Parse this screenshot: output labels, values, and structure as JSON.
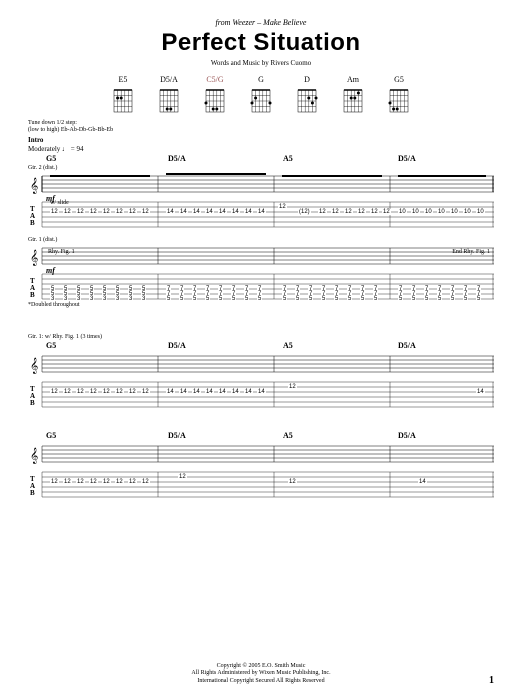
{
  "header": {
    "from_line": "from Weezer – Make Believe",
    "title": "Perfect Situation",
    "credits": "Words and Music by Rivers Cuomo"
  },
  "chords": [
    {
      "name": "E5",
      "highlight": false
    },
    {
      "name": "D5/A",
      "highlight": false
    },
    {
      "name": "C5/G",
      "highlight": true
    },
    {
      "name": "G",
      "highlight": false
    },
    {
      "name": "D",
      "highlight": false
    },
    {
      "name": "Am",
      "highlight": false
    },
    {
      "name": "G5",
      "highlight": false
    }
  ],
  "tuning": {
    "line1": "Tune down 1/2 step:",
    "line2": "(low to high) Eb-Ab-Db-Gb-Bb-Eb"
  },
  "intro": {
    "section": "Intro",
    "tempo": "Moderately ♩ = 94",
    "gtr1": "Gtr. 2 (dist.)",
    "gtr2": "Gtr. 1 (dist.)",
    "dynamic": "mf",
    "tech": "w/ slide",
    "rhy_fig": "Rhy. Fig. 1",
    "end_rhy": "End Rhy. Fig. 1",
    "doubled": "*Doubled throughout"
  },
  "chord_progression": {
    "c1": "G5",
    "c2": "D5/A",
    "c3": "A5",
    "c4": "D5/A"
  },
  "system2_label": "Gtr. 1: w/ Rhy. Fig. 1 (3 times)",
  "tab_data": {
    "sys1_gtr2": {
      "bar1": [
        "12",
        "12",
        "12",
        "12",
        "12",
        "12",
        "12",
        "12"
      ],
      "bar2": [
        "14",
        "14",
        "14",
        "14",
        "14",
        "14",
        "14",
        "14"
      ],
      "bar3_slide": "12",
      "bar3": [
        "(12)",
        "12",
        "12",
        "12",
        "12",
        "12",
        "12"
      ],
      "bar4": [
        "10",
        "10",
        "10",
        "10",
        "10",
        "10",
        "10",
        "10"
      ]
    },
    "sys1_gtr1": {
      "strings_35": [
        "5",
        "5",
        "5",
        "5",
        "5",
        "5",
        "5",
        "5"
      ],
      "strings_35b": [
        "3",
        "3",
        "3",
        "3",
        "3",
        "3",
        "3",
        "3"
      ],
      "bar2_top": [
        "7",
        "7",
        "7",
        "7",
        "7",
        "7",
        "7",
        "7"
      ],
      "bar2_bot": [
        "5",
        "5",
        "5",
        "5",
        "5",
        "5",
        "5",
        "5"
      ],
      "bar3_top": [
        "7",
        "7",
        "7",
        "7",
        "7",
        "7",
        "7",
        "7"
      ],
      "bar3_bot": [
        "5",
        "5",
        "5",
        "5",
        "5",
        "5",
        "5",
        "5"
      ],
      "bar4_top": [
        "7",
        "7",
        "7",
        "7",
        "7",
        "7",
        "7",
        "7"
      ],
      "bar4_bot": [
        "5",
        "5",
        "5",
        "5",
        "5",
        "5",
        "5",
        "5"
      ]
    },
    "sys2": {
      "bar1": [
        "12",
        "12",
        "12",
        "12",
        "12",
        "12",
        "12",
        "12"
      ],
      "bar2": [
        "14",
        "14",
        "14",
        "14",
        "14",
        "14",
        "14",
        "14"
      ],
      "bar3_hold": "12",
      "bar4_end": "14"
    },
    "sys3": {
      "bar1": [
        "12",
        "12",
        "12",
        "12",
        "12",
        "12",
        "12",
        "12"
      ],
      "bar2_slide": "12",
      "bar3": "12",
      "bar4": "14"
    }
  },
  "footer": {
    "copyright": "Copyright © 2005 E.O. Smith Music",
    "rights1": "All Rights Administered by Wixen Music Publishing, Inc.",
    "rights2": "International Copyright Secured   All Rights Reserved"
  },
  "page_number": "1"
}
